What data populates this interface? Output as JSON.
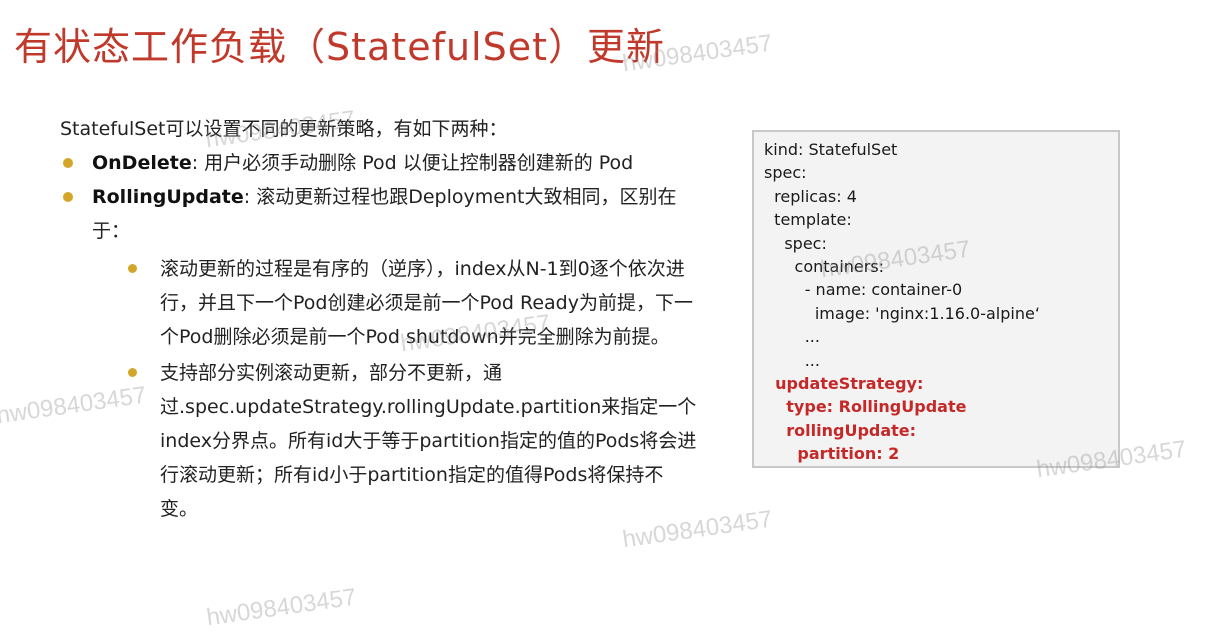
{
  "title": "有状态工作负载（StatefulSet）更新",
  "intro": "StatefulSet可以设置不同的更新策略，有如下两种：",
  "bullets": [
    {
      "term": "OnDelete",
      "text": ": 用户必须手动删除 Pod 以便让控制器创建新的 Pod"
    },
    {
      "term": "RollingUpdate",
      "text": ": 滚动更新过程也跟Deployment大致相同，区别在于："
    }
  ],
  "sub_bullets": [
    "滚动更新的过程是有序的（逆序），index从N-1到0逐个依次进行，并且下一个Pod创建必须是前一个Pod Ready为前提，下一个Pod删除必须是前一个Pod shutdown并完全删除为前提。",
    "支持部分实例滚动更新，部分不更新，通过.spec.updateStrategy.rollingUpdate.partition来指定一个index分界点。所有id大于等于partition指定的值的Pods将会进行滚动更新；所有id小于partition指定的值得Pods将保持不变。"
  ],
  "code_lines": [
    {
      "text": "kind: StatefulSet",
      "highlight": false
    },
    {
      "text": "spec:",
      "highlight": false
    },
    {
      "text": "  replicas: 4",
      "highlight": false
    },
    {
      "text": "  template:",
      "highlight": false
    },
    {
      "text": "    spec:",
      "highlight": false
    },
    {
      "text": "      containers:",
      "highlight": false
    },
    {
      "text": "        - name: container-0",
      "highlight": false
    },
    {
      "text": "          image: 'nginx:1.16.0-alpine‘",
      "highlight": false
    },
    {
      "text": "        ...",
      "highlight": false
    },
    {
      "text": "        ...",
      "highlight": false
    },
    {
      "text": "  updateStrategy:",
      "highlight": true
    },
    {
      "text": "    type: RollingUpdate",
      "highlight": true
    },
    {
      "text": "    rollingUpdate:",
      "highlight": true
    },
    {
      "text": "      partition: 2",
      "highlight": true
    }
  ],
  "watermark": "hw098403457",
  "colors": {
    "title": "#c0392b",
    "bullet": "#d4a528",
    "highlight": "#c62828"
  }
}
